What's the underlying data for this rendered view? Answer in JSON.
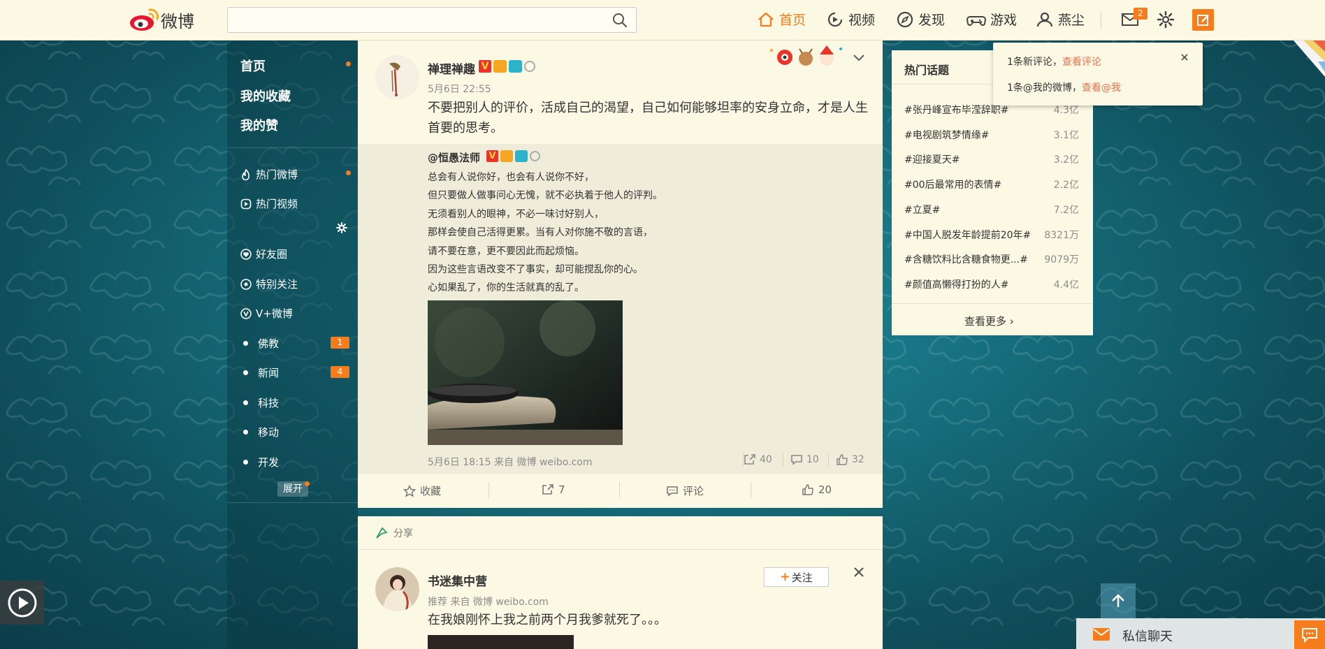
{
  "nav": {
    "logo_text": "微博",
    "search_placeholder": "",
    "items": [
      {
        "label": "首页",
        "icon": "home-icon",
        "active": true
      },
      {
        "label": "视频",
        "icon": "video-icon",
        "active": false
      },
      {
        "label": "发现",
        "icon": "compass-icon",
        "active": false
      },
      {
        "label": "游戏",
        "icon": "gamepad-icon",
        "active": false
      },
      {
        "label": "燕尘",
        "icon": "user-icon",
        "active": false
      }
    ],
    "message_badge": "2",
    "accent_color": "#f77c1b"
  },
  "sidebar": {
    "main": [
      "首页",
      "我的收藏",
      "我的赞"
    ],
    "hot": [
      "热门微博",
      "热门视频"
    ],
    "groups": [
      {
        "label": "好友圈",
        "icon": "heart-icon"
      },
      {
        "label": "特别关注",
        "icon": "eye-icon"
      },
      {
        "label": "V+微博",
        "icon": "vplus-icon"
      }
    ],
    "topics": [
      {
        "label": "佛教",
        "badge": "1"
      },
      {
        "label": "新闻",
        "badge": "4"
      },
      {
        "label": "科技",
        "badge": ""
      },
      {
        "label": "移动",
        "badge": ""
      },
      {
        "label": "开发",
        "badge": ""
      }
    ],
    "expand": "展开"
  },
  "post1": {
    "username": "禅理禅趣",
    "time": "5月6日 22:55",
    "text_line1": "不要把别人的评价，活成自己的渴望，自己如何能够坦率的安身立命，才是人生",
    "text_line2": "首要的思考。",
    "quote": {
      "username": "@恒愚法师",
      "lines": [
        "总会有人说你好，也会有人说你不好，",
        "但只要做人做事问心无愧，就不必执着于他人的评判。",
        "无须看别人的眼神，不必一味讨好别人，",
        "那样会使自己活得更累。当有人对你施不敬的言语，",
        "请不要在意，更不要因此而起烦恼。",
        "因为这些言语改变不了事实，却可能搅乱你的心。",
        "心如果乱了，你的生活就真的乱了。"
      ],
      "meta": "5月6日 18:15 来自 微博 weibo.com",
      "reposts": "40",
      "comments": "10",
      "likes": "32"
    },
    "actions": {
      "favorite": "收藏",
      "repost": "7",
      "comment": "评论",
      "like": "20"
    }
  },
  "post2": {
    "share_label": "分享",
    "username": "书迷集中营",
    "follow": "关注",
    "meta": "推荐 来自 微博 weibo.com",
    "text": "在我娘刚怀上我之前两个月我爹就死了。。。"
  },
  "trends": {
    "title": "热门话题",
    "items": [
      {
        "name": "#张丹峰宣布毕滢辞职#",
        "value": "4.3亿"
      },
      {
        "name": "#电视剧筑梦情缘#",
        "value": "3.1亿"
      },
      {
        "name": "#迎接夏天#",
        "value": "3.2亿"
      },
      {
        "name": "#00后最常用的表情#",
        "value": "2.2亿"
      },
      {
        "name": "#立夏#",
        "value": "7.2亿"
      },
      {
        "name": "#中国人脱发年龄提前20年#",
        "value": "8321万"
      },
      {
        "name": "#含糖饮料比含糖食物更...#",
        "value": "9079万"
      },
      {
        "name": "#颜值高懒得打扮的人#",
        "value": "4.4亿"
      }
    ],
    "more": "查看更多"
  },
  "popup": {
    "line1_text": "1条新评论，",
    "line1_link": "查看评论",
    "line2_text": "1条@我的微博，",
    "line2_link": "查看@我"
  },
  "chat": {
    "label": "私信聊天"
  }
}
